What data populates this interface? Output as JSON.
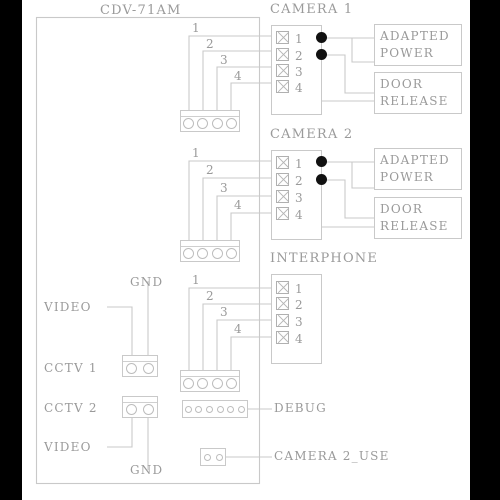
{
  "diagram": {
    "title": "CDV-71AM",
    "board_label": "CDV-71AM"
  },
  "sections": [
    {
      "heading": "CAMERA 1",
      "terminals": [
        "1",
        "2",
        "3",
        "4"
      ],
      "wire_numbers": [
        "1",
        "2",
        "3",
        "4"
      ],
      "outputs": [
        {
          "line1": "ADAPTED",
          "line2": "POWER"
        },
        {
          "line1": "DOOR",
          "line2": "RELEASE"
        }
      ]
    },
    {
      "heading": "CAMERA 2",
      "terminals": [
        "1",
        "2",
        "3",
        "4"
      ],
      "wire_numbers": [
        "1",
        "2",
        "3",
        "4"
      ],
      "outputs": [
        {
          "line1": "ADAPTED",
          "line2": "POWER"
        },
        {
          "line1": "DOOR",
          "line2": "RELEASE"
        }
      ]
    },
    {
      "heading": "INTERPHONE",
      "terminals": [
        "1",
        "2",
        "3",
        "4"
      ],
      "wire_numbers": [
        "1",
        "2",
        "3",
        "4"
      ],
      "outputs": []
    }
  ],
  "cctv": [
    {
      "label": "CCTV 1",
      "pin_left": "VIDEO",
      "pin_right": "GND"
    },
    {
      "label": "CCTV 2",
      "pin_left": "VIDEO",
      "pin_right": "GND"
    }
  ],
  "headers": [
    {
      "label": "DEBUG",
      "pin_count": 6
    },
    {
      "label": "CAMERA 2_USE",
      "pin_count": 2
    }
  ],
  "colors": {
    "line": "#c9c9c9",
    "text": "#9a9a9a",
    "dot": "#111111",
    "background": "#ffffff",
    "letterbox": "#000000"
  }
}
